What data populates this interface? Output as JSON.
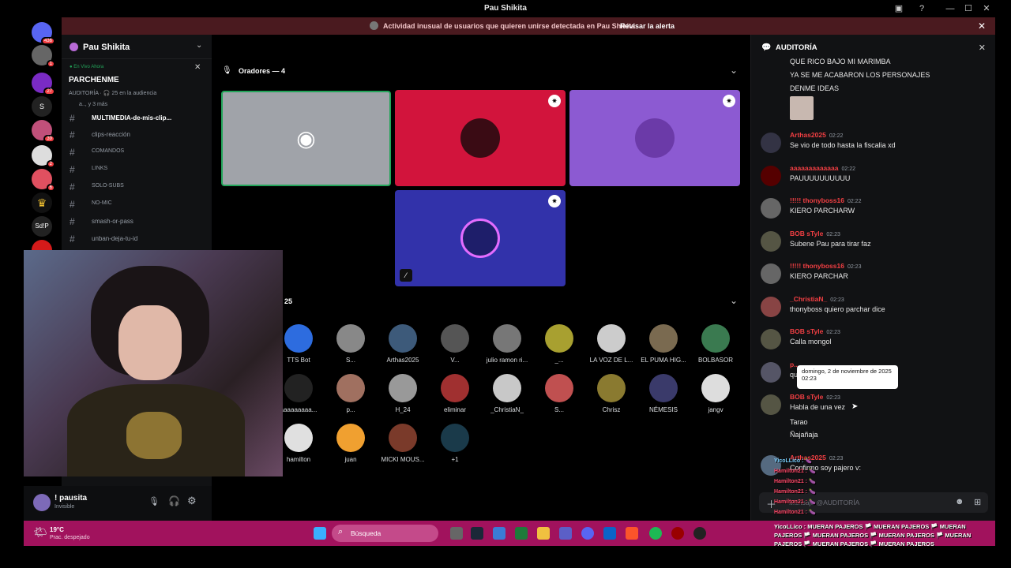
{
  "window": {
    "title": "Pau Shikita"
  },
  "alert": {
    "message": "Actividad inusual de usuarios que quieren unirse detectada en Pau Shikita",
    "action": "Revisar la alerta"
  },
  "guilds": {
    "badges": [
      "436",
      "1",
      "27",
      "39",
      "2",
      "6"
    ],
    "label_s": "S",
    "label_sdp": "Sd!P"
  },
  "sidebar": {
    "server_name": "Pau Shikita",
    "live_label": "En Vivo Ahora",
    "channel_title": "PARCHENME",
    "subtitle_audience": "AUDITORÍA · 🎧 25 en la audiencia",
    "subtitle_more": "a.., y 3 más",
    "channels": [
      {
        "name": "MULTIMEDIA-de-mis-clip..."
      },
      {
        "name": "clips-reacción"
      },
      {
        "name": "COMANDOS"
      },
      {
        "name": "LINKS"
      },
      {
        "name": "SOLO-SUBS"
      },
      {
        "name": "NO-MIC"
      },
      {
        "name": "smash-or-pass"
      },
      {
        "name": "unban-deja-tu-id"
      }
    ]
  },
  "user": {
    "name": "! pausita",
    "status": "Invisible"
  },
  "stage": {
    "speakers_header": "Oradores — 4",
    "audience_count": "25",
    "audience": [
      "TTS Bot",
      "S...",
      "Arthas2025",
      "V...",
      "julio ramon ri...",
      "_...",
      "LA VOZ DE L...",
      "EL PUMA HIG...",
      "BOLBASOR",
      "aaaaaaaaa...",
      "p...",
      "H_24",
      "eliminar",
      "_ChristiaN_",
      "S...",
      "Chrisz",
      "NÉMESIS",
      "jangv",
      "hamilton",
      "juan",
      "MICKI MOUS...",
      "+1"
    ]
  },
  "chat": {
    "header": "AUDITORÍA",
    "top_lines": [
      "QUE RICO BAJO MI MARIMBA",
      "YA SE ME ACABARON LOS PERSONAJES",
      "DENME IDEAS"
    ],
    "messages": [
      {
        "author": "Arthas2025",
        "time": "02:22",
        "text": "Se vio de todo hasta la fiscalia xd"
      },
      {
        "author": "aaaaaaaaaaaaa",
        "time": "02:22",
        "text": "PAUUUUUUUUUU"
      },
      {
        "author": "!!!!! thonyboss16",
        "time": "02:22",
        "text": "KIERO PARCHARW"
      },
      {
        "author": "BOB sTyle",
        "time": "02:23",
        "text": "Subene Pau para tirar faz"
      },
      {
        "author": "!!!!! thonyboss16",
        "time": "02:23",
        "text": "KIERO PARCHAR"
      },
      {
        "author": "_ChristiaN_",
        "time": "02:23",
        "text": "thonyboss quiero parchar dice"
      },
      {
        "author": "BOB sTyle",
        "time": "02:23",
        "text": "Calla mongol"
      },
      {
        "author": "p...",
        "time": "",
        "text": "qu... chill"
      },
      {
        "author": "BOB sTyle",
        "time": "02:23",
        "text": "Habla de una vez"
      }
    ],
    "extra_lines": [
      "Tarao",
      "Ñajañaja"
    ],
    "last": {
      "author": "Arthas2025",
      "time": "02:23",
      "text": "Confirmo soy pajero v:"
    },
    "tooltip": "domingo, 2 de noviembre de 2025 02:23",
    "input_placeholder": "Mensaje @AUDITORÍA"
  },
  "overlay": {
    "lines": [
      "YicoLLico : 🍆",
      "Hamilton21 : 🍆",
      "Hamilton21 : 🍆",
      "Hamilton21 : 🍆",
      "Hamilton21 : 🍆",
      "Hamilton21 : 🍆"
    ],
    "banner": "YicoLLico : MUERAN PAJEROS 🏳️ MUERAN PAJEROS 🏳️ MUERAN PAJEROS 🏳️ MUERAN PAJEROS 🏳️ MUERAN PAJEROS 🏳️ MUERAN PAJEROS 🏳️ MUERAN PAJEROS 🏳️ MUERAN PAJEROS"
  },
  "taskbar": {
    "weather_temp": "19°C",
    "weather_desc": "Prac. despejado",
    "search_placeholder": "Búsqueda"
  },
  "colors": {
    "speaker_red": "#d2143c",
    "speaker_purple": "#8c5ad2",
    "speaker_blue": "#3232aa",
    "taskbar": "#a1125d",
    "alert_bg": "#4a1a1f"
  }
}
